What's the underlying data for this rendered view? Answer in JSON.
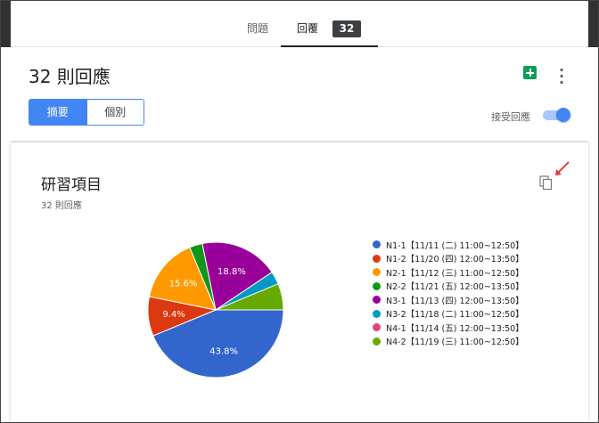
{
  "tabs": {
    "questions": "問題",
    "responses": "回覆",
    "count": "32"
  },
  "header": {
    "title": "32 則回應",
    "seg_summary": "摘要",
    "seg_individual": "個別",
    "accepting_label": "接受回應",
    "accepting": true
  },
  "card": {
    "title": "研習項目",
    "subtitle": "32 則回應"
  },
  "chart_data": {
    "type": "pie",
    "categories": [
      "N1-1【11/11 (二) 11:00~12:50】",
      "N1-2【11/20 (四) 12:00~13:50】",
      "N2-1【11/12 (三) 11:00~12:50】",
      "N2-2【11/21 (五) 12:00~13:50】",
      "N3-1【11/13 (四) 12:00~13:50】",
      "N3-2【11/18 (二) 11:00~12:50】",
      "N4-1【11/14 (五) 12:00~13:50】",
      "N4-2【11/19 (三) 11:00~12:50】"
    ],
    "values": [
      43.8,
      9.4,
      15.6,
      3.1,
      18.8,
      3.1,
      0,
      6.3
    ],
    "slice_labels": [
      "43.8%",
      "9.4%",
      "15.6%",
      "",
      "18.8%",
      "",
      "",
      ""
    ],
    "colors": [
      "#3366cc",
      "#dc3912",
      "#ff9900",
      "#109618",
      "#990099",
      "#0099c6",
      "#dd4477",
      "#66aa00"
    ]
  }
}
